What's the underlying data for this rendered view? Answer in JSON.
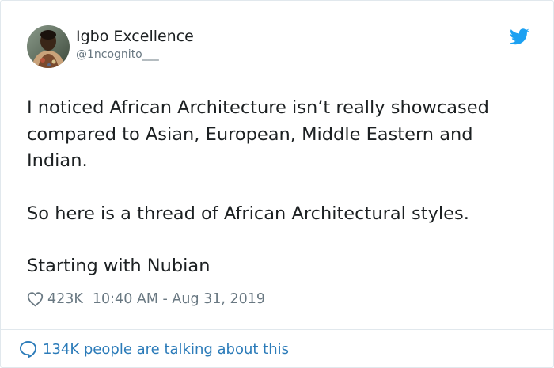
{
  "tweet": {
    "author": {
      "display_name": "Igbo Excellence",
      "handle": "@1ncognito___",
      "avatar_icon": "user-avatar-photo"
    },
    "platform_icon": "twitter-bird-icon",
    "text_paragraphs": [
      "I noticed African Architecture isn’t really showcased compared to Asian, European, Middle Eastern and Indian.",
      "So here is a thread of African Architectural styles.",
      "Starting with Nubian"
    ],
    "likes": "423K",
    "timestamp": "10:40 AM - Aug 31, 2019",
    "like_icon": "heart-outline-icon",
    "footer_icon": "speech-bubble-icon",
    "discussion_text": "134K people are talking about this"
  },
  "colors": {
    "text_primary": "#1c2022",
    "text_secondary": "#697882",
    "link": "#2b7bb9",
    "twitter_blue": "#1da1f2",
    "border": "#e1e8ed"
  }
}
